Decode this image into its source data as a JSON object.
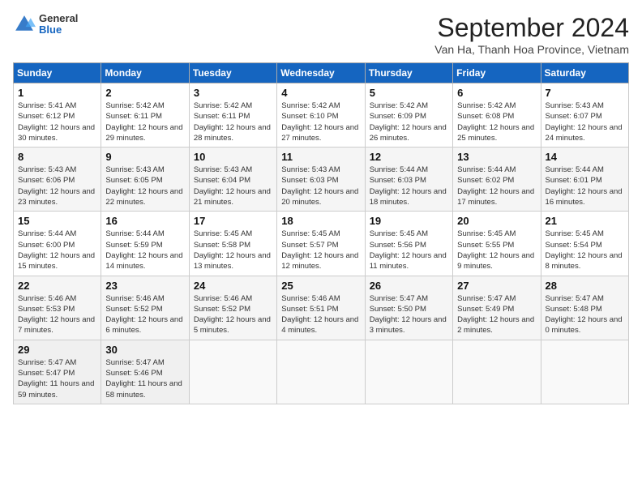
{
  "header": {
    "logo_general": "General",
    "logo_blue": "Blue",
    "month_title": "September 2024",
    "location": "Van Ha, Thanh Hoa Province, Vietnam"
  },
  "days_of_week": [
    "Sunday",
    "Monday",
    "Tuesday",
    "Wednesday",
    "Thursday",
    "Friday",
    "Saturday"
  ],
  "weeks": [
    [
      {
        "day": "1",
        "sunrise": "Sunrise: 5:41 AM",
        "sunset": "Sunset: 6:12 PM",
        "daylight": "Daylight: 12 hours and 30 minutes."
      },
      {
        "day": "2",
        "sunrise": "Sunrise: 5:42 AM",
        "sunset": "Sunset: 6:11 PM",
        "daylight": "Daylight: 12 hours and 29 minutes."
      },
      {
        "day": "3",
        "sunrise": "Sunrise: 5:42 AM",
        "sunset": "Sunset: 6:11 PM",
        "daylight": "Daylight: 12 hours and 28 minutes."
      },
      {
        "day": "4",
        "sunrise": "Sunrise: 5:42 AM",
        "sunset": "Sunset: 6:10 PM",
        "daylight": "Daylight: 12 hours and 27 minutes."
      },
      {
        "day": "5",
        "sunrise": "Sunrise: 5:42 AM",
        "sunset": "Sunset: 6:09 PM",
        "daylight": "Daylight: 12 hours and 26 minutes."
      },
      {
        "day": "6",
        "sunrise": "Sunrise: 5:42 AM",
        "sunset": "Sunset: 6:08 PM",
        "daylight": "Daylight: 12 hours and 25 minutes."
      },
      {
        "day": "7",
        "sunrise": "Sunrise: 5:43 AM",
        "sunset": "Sunset: 6:07 PM",
        "daylight": "Daylight: 12 hours and 24 minutes."
      }
    ],
    [
      {
        "day": "8",
        "sunrise": "Sunrise: 5:43 AM",
        "sunset": "Sunset: 6:06 PM",
        "daylight": "Daylight: 12 hours and 23 minutes."
      },
      {
        "day": "9",
        "sunrise": "Sunrise: 5:43 AM",
        "sunset": "Sunset: 6:05 PM",
        "daylight": "Daylight: 12 hours and 22 minutes."
      },
      {
        "day": "10",
        "sunrise": "Sunrise: 5:43 AM",
        "sunset": "Sunset: 6:04 PM",
        "daylight": "Daylight: 12 hours and 21 minutes."
      },
      {
        "day": "11",
        "sunrise": "Sunrise: 5:43 AM",
        "sunset": "Sunset: 6:03 PM",
        "daylight": "Daylight: 12 hours and 20 minutes."
      },
      {
        "day": "12",
        "sunrise": "Sunrise: 5:44 AM",
        "sunset": "Sunset: 6:03 PM",
        "daylight": "Daylight: 12 hours and 18 minutes."
      },
      {
        "day": "13",
        "sunrise": "Sunrise: 5:44 AM",
        "sunset": "Sunset: 6:02 PM",
        "daylight": "Daylight: 12 hours and 17 minutes."
      },
      {
        "day": "14",
        "sunrise": "Sunrise: 5:44 AM",
        "sunset": "Sunset: 6:01 PM",
        "daylight": "Daylight: 12 hours and 16 minutes."
      }
    ],
    [
      {
        "day": "15",
        "sunrise": "Sunrise: 5:44 AM",
        "sunset": "Sunset: 6:00 PM",
        "daylight": "Daylight: 12 hours and 15 minutes."
      },
      {
        "day": "16",
        "sunrise": "Sunrise: 5:44 AM",
        "sunset": "Sunset: 5:59 PM",
        "daylight": "Daylight: 12 hours and 14 minutes."
      },
      {
        "day": "17",
        "sunrise": "Sunrise: 5:45 AM",
        "sunset": "Sunset: 5:58 PM",
        "daylight": "Daylight: 12 hours and 13 minutes."
      },
      {
        "day": "18",
        "sunrise": "Sunrise: 5:45 AM",
        "sunset": "Sunset: 5:57 PM",
        "daylight": "Daylight: 12 hours and 12 minutes."
      },
      {
        "day": "19",
        "sunrise": "Sunrise: 5:45 AM",
        "sunset": "Sunset: 5:56 PM",
        "daylight": "Daylight: 12 hours and 11 minutes."
      },
      {
        "day": "20",
        "sunrise": "Sunrise: 5:45 AM",
        "sunset": "Sunset: 5:55 PM",
        "daylight": "Daylight: 12 hours and 9 minutes."
      },
      {
        "day": "21",
        "sunrise": "Sunrise: 5:45 AM",
        "sunset": "Sunset: 5:54 PM",
        "daylight": "Daylight: 12 hours and 8 minutes."
      }
    ],
    [
      {
        "day": "22",
        "sunrise": "Sunrise: 5:46 AM",
        "sunset": "Sunset: 5:53 PM",
        "daylight": "Daylight: 12 hours and 7 minutes."
      },
      {
        "day": "23",
        "sunrise": "Sunrise: 5:46 AM",
        "sunset": "Sunset: 5:52 PM",
        "daylight": "Daylight: 12 hours and 6 minutes."
      },
      {
        "day": "24",
        "sunrise": "Sunrise: 5:46 AM",
        "sunset": "Sunset: 5:52 PM",
        "daylight": "Daylight: 12 hours and 5 minutes."
      },
      {
        "day": "25",
        "sunrise": "Sunrise: 5:46 AM",
        "sunset": "Sunset: 5:51 PM",
        "daylight": "Daylight: 12 hours and 4 minutes."
      },
      {
        "day": "26",
        "sunrise": "Sunrise: 5:47 AM",
        "sunset": "Sunset: 5:50 PM",
        "daylight": "Daylight: 12 hours and 3 minutes."
      },
      {
        "day": "27",
        "sunrise": "Sunrise: 5:47 AM",
        "sunset": "Sunset: 5:49 PM",
        "daylight": "Daylight: 12 hours and 2 minutes."
      },
      {
        "day": "28",
        "sunrise": "Sunrise: 5:47 AM",
        "sunset": "Sunset: 5:48 PM",
        "daylight": "Daylight: 12 hours and 0 minutes."
      }
    ],
    [
      {
        "day": "29",
        "sunrise": "Sunrise: 5:47 AM",
        "sunset": "Sunset: 5:47 PM",
        "daylight": "Daylight: 11 hours and 59 minutes."
      },
      {
        "day": "30",
        "sunrise": "Sunrise: 5:47 AM",
        "sunset": "Sunset: 5:46 PM",
        "daylight": "Daylight: 11 hours and 58 minutes."
      },
      null,
      null,
      null,
      null,
      null
    ]
  ]
}
